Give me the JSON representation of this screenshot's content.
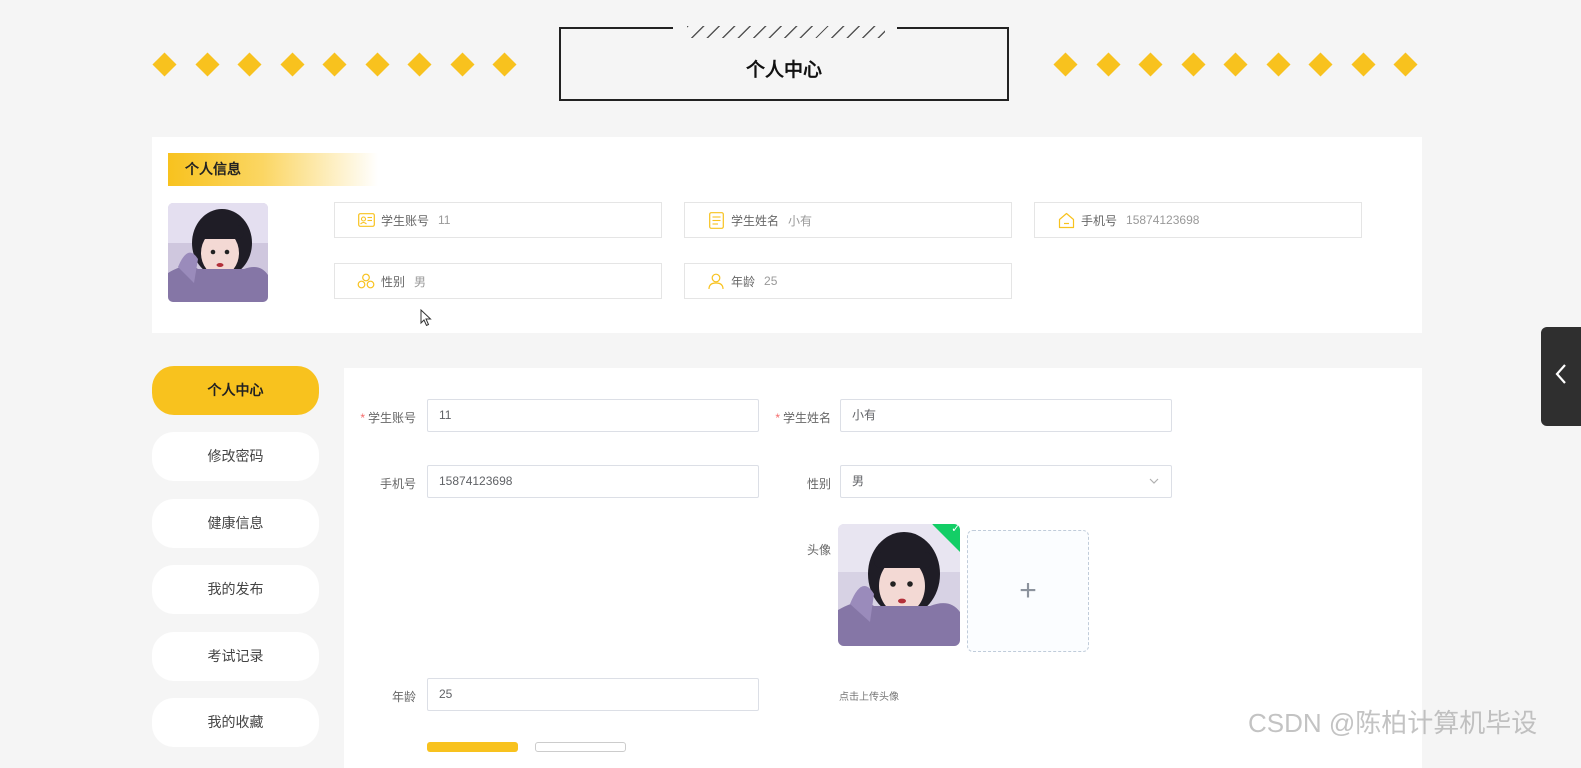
{
  "page": {
    "title": "个人中心"
  },
  "info": {
    "header": "个人信息",
    "cards": [
      {
        "label": "学生账号",
        "value": "11",
        "icon": "id-card-icon"
      },
      {
        "label": "学生姓名",
        "value": "小有",
        "icon": "document-icon"
      },
      {
        "label": "手机号",
        "value": "15874123698",
        "icon": "home-icon"
      },
      {
        "label": "性别",
        "value": "男",
        "icon": "group-icon"
      },
      {
        "label": "年龄",
        "value": "25",
        "icon": "user-icon"
      }
    ]
  },
  "sidebar": {
    "items": [
      {
        "label": "个人中心",
        "active": true
      },
      {
        "label": "修改密码"
      },
      {
        "label": "健康信息"
      },
      {
        "label": "我的发布"
      },
      {
        "label": "考试记录"
      },
      {
        "label": "我的收藏"
      }
    ]
  },
  "form": {
    "account_label": "学生账号",
    "account_value": "11",
    "name_label": "学生姓名",
    "name_value": "小有",
    "phone_label": "手机号",
    "phone_value": "15874123698",
    "gender_label": "性别",
    "gender_value": "男",
    "avatar_label": "头像",
    "upload_tip": "点击上传头像",
    "age_label": "年龄",
    "age_value": "25",
    "required_mark": "*"
  },
  "watermark": "CSDN @陈柏计算机毕设",
  "colors": {
    "accent": "#f8c21e",
    "panel": "#ffffff",
    "background": "#f5f5f5",
    "success": "#13ce66"
  }
}
